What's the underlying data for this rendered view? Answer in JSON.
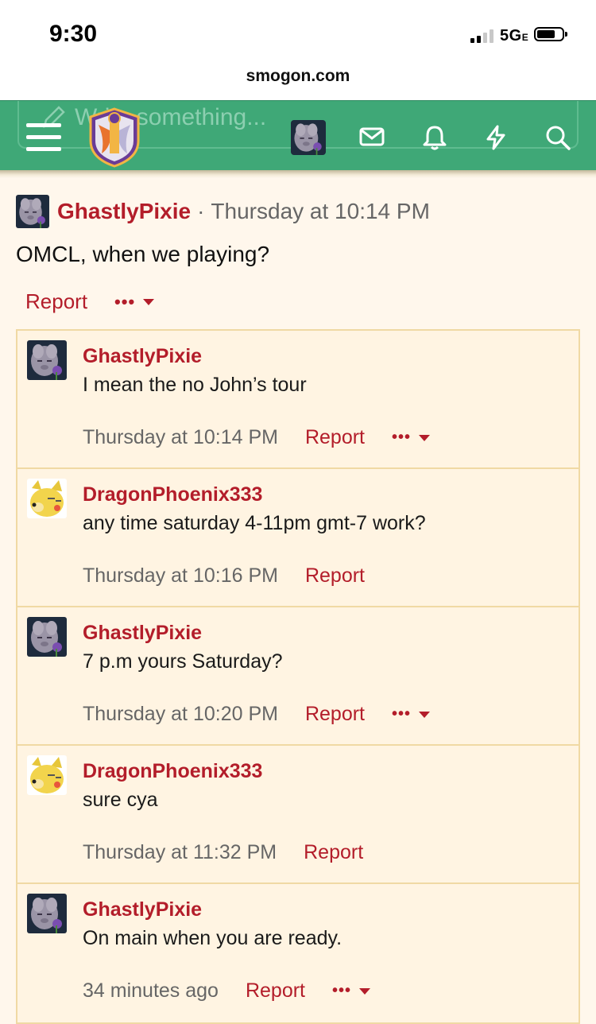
{
  "status_bar": {
    "time": "9:30",
    "network": "5G",
    "network_suffix": "E"
  },
  "browser": {
    "url": "smogon.com"
  },
  "nav": {
    "search_placeholder": "Write something...",
    "menu_icon": "hamburger-icon",
    "logo_icon": "smogon-shield-logo",
    "icons": [
      "envelope-icon",
      "bell-icon",
      "lightning-icon",
      "search-icon"
    ],
    "accent_color": "#3fa877"
  },
  "post": {
    "author": "GhastlyPixie",
    "separator": "·",
    "date": "Thursday at 10:14 PM",
    "body": "OMCL, when we playing?",
    "report_label": "Report",
    "more_label": "•••"
  },
  "comments": [
    {
      "author": "GhastlyPixie",
      "avatar": "ghost-avatar",
      "text": "I mean the no John’s tour",
      "date": "Thursday at 10:14 PM",
      "report_label": "Report",
      "more_label": "•••",
      "has_more": true
    },
    {
      "author": "DragonPhoenix333",
      "avatar": "pikachu-doge-avatar",
      "text": "any time saturday 4-11pm gmt-7 work?",
      "date": "Thursday at 10:16 PM",
      "report_label": "Report",
      "has_more": false
    },
    {
      "author": "GhastlyPixie",
      "avatar": "ghost-avatar",
      "text": "7 p.m yours Saturday?",
      "date": "Thursday at 10:20 PM",
      "report_label": "Report",
      "more_label": "•••",
      "has_more": true
    },
    {
      "author": "DragonPhoenix333",
      "avatar": "pikachu-doge-avatar",
      "text": "sure cya",
      "date": "Thursday at 11:32 PM",
      "report_label": "Report",
      "has_more": false
    },
    {
      "author": "GhastlyPixie",
      "avatar": "ghost-avatar",
      "text": "On main when you are ready.",
      "date": "34 minutes ago",
      "report_label": "Report",
      "more_label": "•••",
      "has_more": true
    }
  ]
}
